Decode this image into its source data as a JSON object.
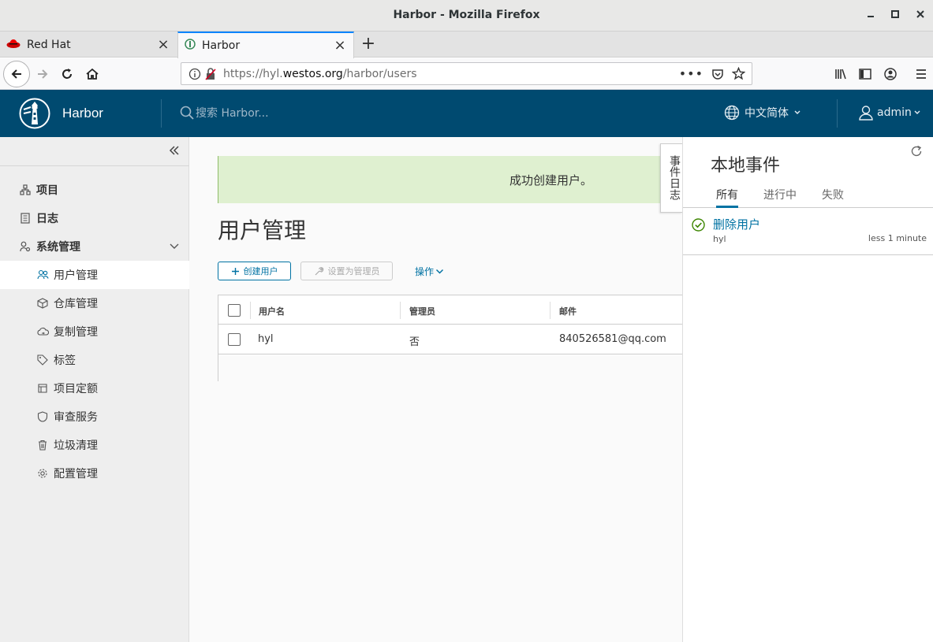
{
  "window": {
    "title": "Harbor - Mozilla Firefox"
  },
  "browser": {
    "tabs": [
      {
        "title": "Red Hat",
        "icon": "redhat-icon"
      },
      {
        "title": "Harbor",
        "icon": "harbor-favicon"
      }
    ],
    "url": {
      "prefix": "https://hyl.",
      "domain": "westos.org",
      "path": "/harbor/users"
    }
  },
  "header": {
    "brand": "Harbor",
    "search_placeholder": "搜索 Harbor...",
    "language": "中文简体",
    "user": "admin"
  },
  "sidebar": {
    "items": [
      {
        "label": "项目",
        "icon": "projects-icon"
      },
      {
        "label": "日志",
        "icon": "logs-icon"
      },
      {
        "label": "系统管理",
        "icon": "admin-icon"
      }
    ],
    "subitems": [
      {
        "label": "用户管理",
        "icon": "users-icon",
        "active": true
      },
      {
        "label": "仓库管理",
        "icon": "registry-icon"
      },
      {
        "label": "复制管理",
        "icon": "replication-icon"
      },
      {
        "label": "标签",
        "icon": "tag-icon"
      },
      {
        "label": "项目定额",
        "icon": "quota-icon"
      },
      {
        "label": "审查服务",
        "icon": "shield-icon"
      },
      {
        "label": "垃圾清理",
        "icon": "trash-icon"
      },
      {
        "label": "配置管理",
        "icon": "gear-icon"
      }
    ]
  },
  "main": {
    "alert": "成功创建用户。",
    "title": "用户管理",
    "buttons": {
      "create": "创建用户",
      "set_admin": "设置为管理员",
      "actions": "操作"
    },
    "table": {
      "columns": [
        "用户名",
        "管理员",
        "邮件"
      ],
      "rows": [
        [
          "hyl",
          "否",
          "840526581@qq.com"
        ]
      ]
    }
  },
  "events": {
    "side_tab": "事件日志",
    "title": "本地事件",
    "tabs": [
      "所有",
      "进行中",
      "失败"
    ],
    "entries": [
      {
        "name": "删除用户",
        "user": "hyl",
        "time": "less 1 minute",
        "status": "success"
      }
    ]
  },
  "colors": {
    "header_bg": "#004a70",
    "accent": "#0072a3",
    "success_alert": "#dff0d0",
    "success_icon": "#3c8500"
  }
}
